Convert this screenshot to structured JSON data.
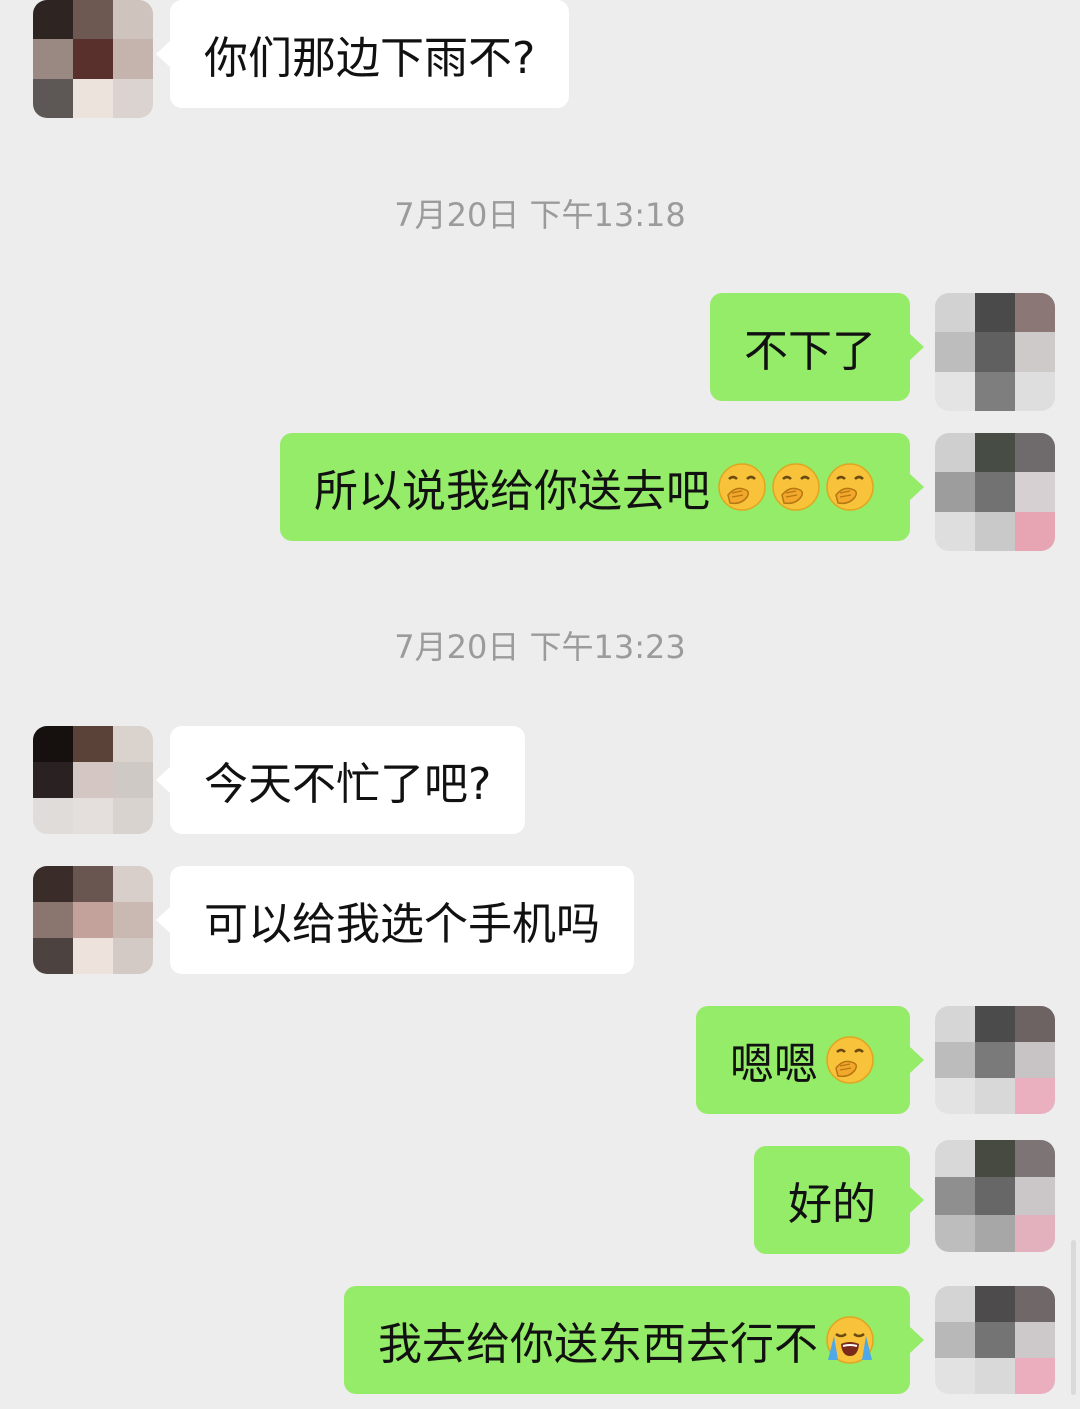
{
  "chat": {
    "timestamps": [
      "7月20日 下午13:18",
      "7月20日 下午13:23"
    ],
    "messages": [
      {
        "side": "in",
        "text": "你们那边下雨不?",
        "emoji": []
      },
      {
        "side": "out",
        "text": "不下了",
        "emoji": []
      },
      {
        "side": "out",
        "text": "所以说我给你送去吧",
        "emoji": [
          "hand-over-mouth-emoji",
          "hand-over-mouth-emoji",
          "hand-over-mouth-emoji"
        ]
      },
      {
        "side": "in",
        "text": "今天不忙了吧?",
        "emoji": []
      },
      {
        "side": "in",
        "text": "可以给我选个手机吗",
        "emoji": []
      },
      {
        "side": "out",
        "text": "嗯嗯",
        "emoji": [
          "hand-over-mouth-emoji"
        ]
      },
      {
        "side": "out",
        "text": "好的",
        "emoji": []
      },
      {
        "side": "out",
        "text": "我去给你送东西去行不",
        "emoji": [
          "loudly-crying-emoji"
        ]
      }
    ]
  },
  "colors": {
    "background": "#ededed",
    "incoming_bubble": "#ffffff",
    "outgoing_bubble": "#95ec69",
    "timestamp_text": "#9b9b9b"
  }
}
